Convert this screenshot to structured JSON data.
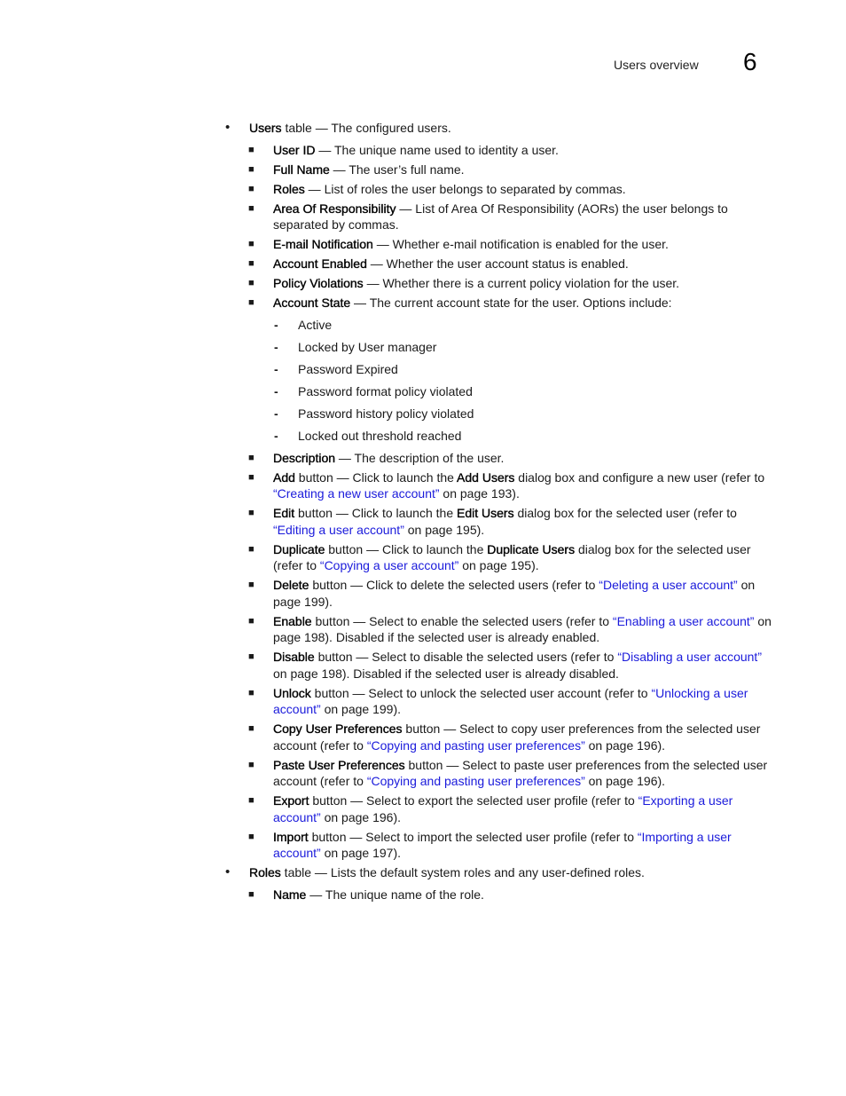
{
  "header": {
    "section_title": "Users overview",
    "chapter_number": "6"
  },
  "users_table": {
    "term": "Users",
    "desc": " table — The configured users.",
    "fields": [
      {
        "term": "User ID",
        "desc": " — The unique name used to identity a user."
      },
      {
        "term": "Full Name",
        "desc": " — The user’s full name."
      },
      {
        "term": "Roles",
        "desc": " — List of roles the user belongs to separated by commas."
      },
      {
        "term": "Area Of Responsibility",
        "desc": " — List of Area Of Responsibility (AORs) the user belongs to separated by commas."
      },
      {
        "term": "E-mail Notification",
        "desc": " — Whether e-mail notification is enabled for the user."
      },
      {
        "term": "Account Enabled",
        "desc": " — Whether the user account status is enabled."
      },
      {
        "term": "Policy Violations",
        "desc": " — Whether there is a current policy violation for the user."
      },
      {
        "term": "Account State",
        "desc": " — The current account state for the user. Options include:"
      }
    ],
    "account_states": [
      "Active",
      "Locked by User manager",
      "Password Expired",
      "Password format policy violated",
      "Password history policy violated",
      "Locked out threshold reached"
    ],
    "description_field": {
      "term": "Description",
      "desc": " — The description of the user."
    },
    "buttons": [
      {
        "term": "Add",
        "pre": " button — Click to launch the ",
        "dialog": "Add Users",
        "mid": " dialog box and configure a new user (refer to ",
        "link": "“Creating a new user account”",
        "post": " on page 193)."
      },
      {
        "term": "Edit",
        "pre": " button — Click to launch the ",
        "dialog": "Edit Users",
        "mid": " dialog box for the selected user (refer to ",
        "link": "“Editing a user account”",
        "post": " on page 195)."
      },
      {
        "term": "Duplicate",
        "pre": " button — Click to launch the ",
        "dialog": "Duplicate Users",
        "mid": " dialog box for the selected user (refer to ",
        "link": "“Copying a user account”",
        "post": " on page 195)."
      },
      {
        "term": "Delete",
        "pre": " button — Click to delete the selected users (refer to ",
        "dialog": "",
        "mid": "",
        "link": "“Deleting a user account”",
        "post": " on page 199)."
      },
      {
        "term": "Enable",
        "pre": " button — Select to enable the selected users (refer to ",
        "dialog": "",
        "mid": "",
        "link": "“Enabling a user account”",
        "post": " on page 198). Disabled if the selected user is already enabled."
      },
      {
        "term": "Disable",
        "pre": " button — Select to disable the selected users (refer to ",
        "dialog": "",
        "mid": "",
        "link": "“Disabling a user account”",
        "post": " on page 198). Disabled if the selected user is already disabled."
      },
      {
        "term": "Unlock",
        "pre": " button — Select to unlock the selected user account (refer to ",
        "dialog": "",
        "mid": "",
        "link": "“Unlocking a user account”",
        "post": " on page 199)."
      },
      {
        "term": "Copy User Preferences",
        "pre": " button — Select to copy user preferences from the selected user account (refer to ",
        "dialog": "",
        "mid": "",
        "link": "“Copying and pasting user preferences”",
        "post": " on page 196)."
      },
      {
        "term": "Paste User Preferences",
        "pre": " button — Select to paste user preferences from the selected user account (refer to ",
        "dialog": "",
        "mid": "",
        "link": "“Copying and pasting user preferences”",
        "post": " on page 196)."
      },
      {
        "term": "Export",
        "pre": " button — Select to export the selected user profile (refer to ",
        "dialog": "",
        "mid": "",
        "link": "“Exporting a user account”",
        "post": " on page 196)."
      },
      {
        "term": "Import",
        "pre": " button — Select to import the selected user profile (refer to ",
        "dialog": "",
        "mid": "",
        "link": "“Importing a user account”",
        "post": " on page 197)."
      }
    ]
  },
  "roles_table": {
    "term": "Roles",
    "desc": " table — Lists the default system roles and any user-defined roles.",
    "fields": [
      {
        "term": "Name",
        "desc": " — The unique name of the role."
      }
    ]
  },
  "glyphs": {
    "round_bullet": "•",
    "square_bullet": "■",
    "dash_bullet": "-"
  }
}
